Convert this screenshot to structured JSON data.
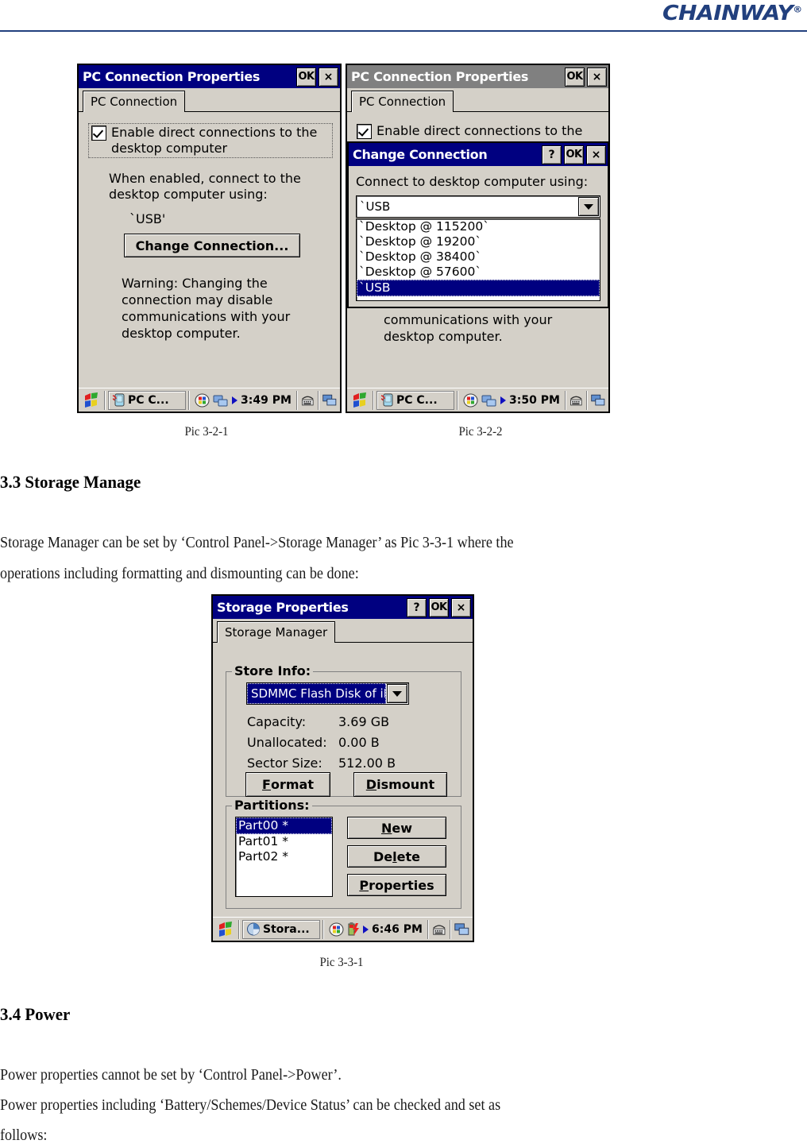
{
  "header": {
    "brand": "CHAINWAY",
    "registered": "®"
  },
  "figures": {
    "pic_3_2_1_caption": "Pic 3-2-1",
    "pic_3_2_2_caption": "Pic 3-2-2",
    "pic_3_3_1_caption": "Pic 3-3-1"
  },
  "sections": [
    {
      "heading": "3.3 Storage Manage",
      "paragraphs": [
        "Storage Manager can be set by ‘Control Panel->Storage Manager’ as Pic 3-3-1 where the",
        "operations including formatting and dismounting can be done:"
      ]
    },
    {
      "heading": "3.4 Power",
      "paragraphs": [
        "Power properties cannot be set by ‘Control Panel->Power’.",
        "Power properties including ‘Battery/Schemes/Device Status’ can be checked and set as",
        "follows:"
      ]
    }
  ],
  "pc_connection_dialog": {
    "title": "PC Connection Properties",
    "buttons": {
      "ok": "OK",
      "close": "×"
    },
    "tab": "PC Connection",
    "checkbox_label_line1": "Enable direct connections to the",
    "checkbox_label_line2": "desktop computer",
    "checkbox_checked": true,
    "info_line1": "When enabled, connect to the",
    "info_line2": "desktop computer using:",
    "connection_value": "`USB'",
    "change_button": "Change Connection...",
    "warning_line1": "Warning: Changing the",
    "warning_line2": "connection may disable",
    "warning_line3": "communications with your",
    "warning_line4": "desktop computer.",
    "taskbar": {
      "task_label": "PC C...",
      "time": "3:49 PM"
    }
  },
  "pc_connection_dialog_2": {
    "title": "PC Connection Properties",
    "buttons": {
      "ok": "OK",
      "close": "×"
    },
    "tab": "PC Connection",
    "checkbox_label_line1": "Enable direct connections to the",
    "warning_line3": "communications with your",
    "warning_line4": "desktop computer.",
    "taskbar": {
      "task_label": "PC C...",
      "time": "3:50 PM"
    }
  },
  "change_connection_dialog": {
    "title": "Change Connection",
    "buttons": {
      "help": "?",
      "ok": "OK",
      "close": "×"
    },
    "prompt": "Connect to desktop computer using:",
    "selected_value": "`USB",
    "options": [
      "`Desktop @ 115200`",
      "`Desktop @ 19200`",
      "`Desktop @ 38400`",
      "`Desktop @ 57600`",
      "`USB"
    ],
    "highlighted_option_index": 4
  },
  "storage_dialog": {
    "title": "Storage Properties",
    "buttons": {
      "help": "?",
      "ok": "OK",
      "close": "×"
    },
    "tab": "Storage Manager",
    "store_info": {
      "group_title": "Store Info:",
      "selected_store": "SDMMC Flash Disk of iN",
      "rows": [
        {
          "label": "Capacity:",
          "value": "3.69 GB"
        },
        {
          "label": "Unallocated:",
          "value": "0.00 B"
        },
        {
          "label": "Sector Size:",
          "value": "512.00 B"
        }
      ],
      "format_button": "Format",
      "dismount_button": "Dismount"
    },
    "partitions": {
      "group_title": "Partitions:",
      "items": [
        "Part00 *",
        "Part01 *",
        "Part02 *"
      ],
      "selected_index": 0,
      "new_button": "New",
      "delete_button": "Delete",
      "properties_button": "Properties"
    },
    "taskbar": {
      "task_label": "Stora...",
      "time": "6:46 PM"
    }
  },
  "colors": {
    "brand": "#22407e",
    "titlebar_active": "#000080",
    "titlebar_inactive": "#808080",
    "window_face": "#d4d0c8",
    "selection": "#000080"
  }
}
